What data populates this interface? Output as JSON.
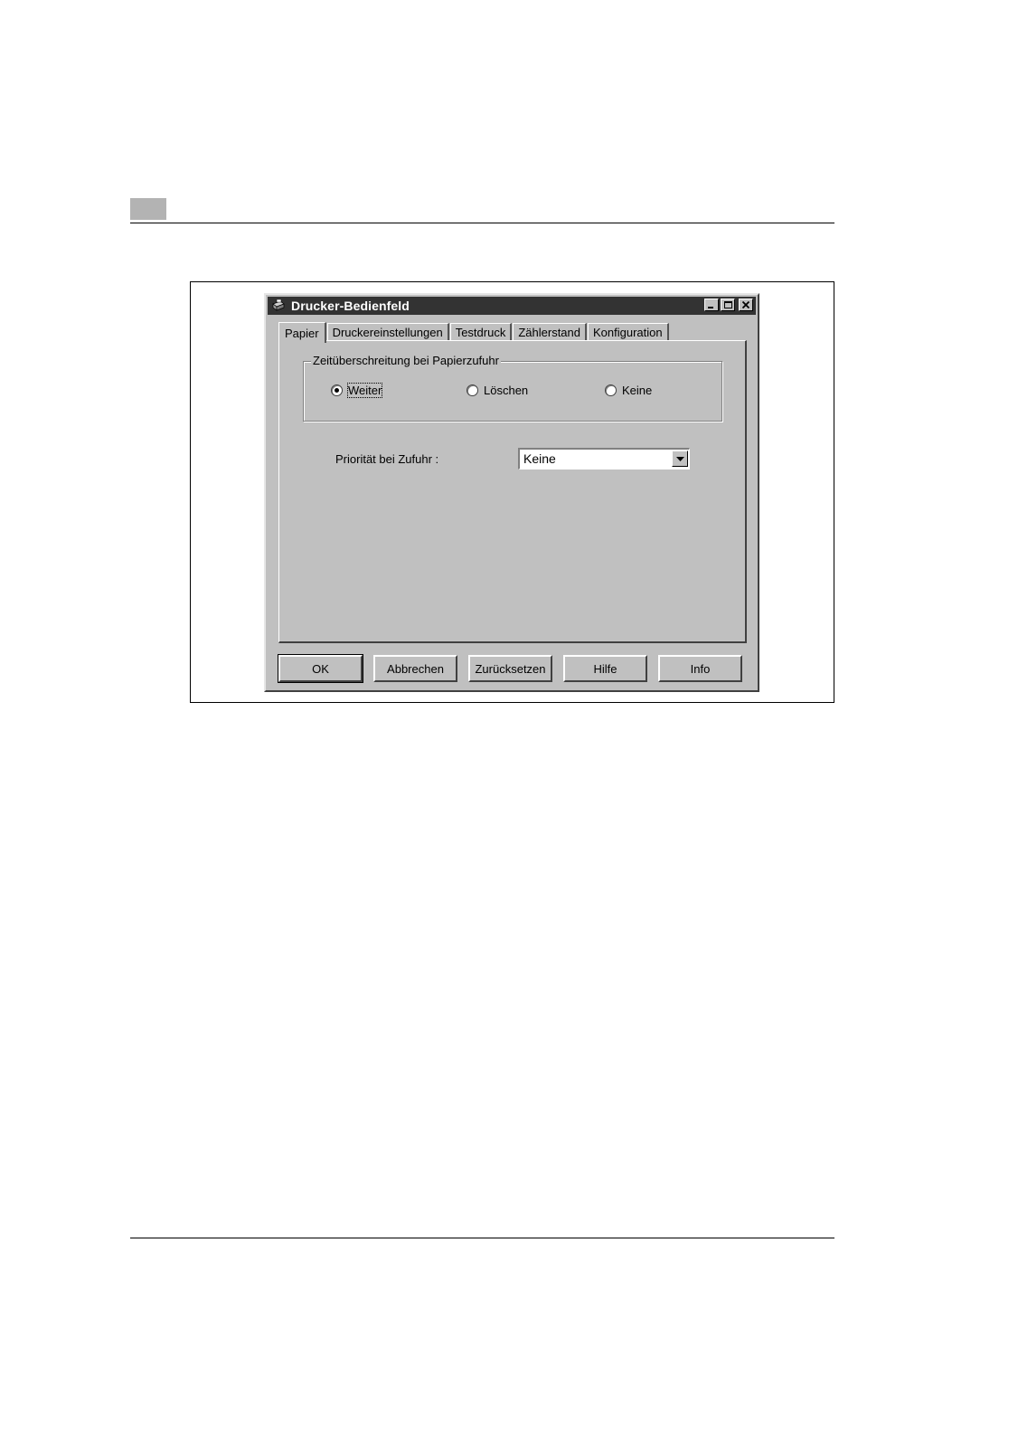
{
  "dialog": {
    "title": "Drucker-Bedienfeld"
  },
  "tabs": [
    {
      "label": "Papier",
      "active": true
    },
    {
      "label": "Druckereinstellungen",
      "active": false
    },
    {
      "label": "Testdruck",
      "active": false
    },
    {
      "label": "Zählerstand",
      "active": false
    },
    {
      "label": "Konfiguration",
      "active": false
    }
  ],
  "paper_feed_timeout": {
    "group_label": "Zeitüberschreitung bei Papierzufuhr",
    "options": [
      {
        "label": "Weiter",
        "selected": true
      },
      {
        "label": "Löschen",
        "selected": false
      },
      {
        "label": "Keine",
        "selected": false
      }
    ]
  },
  "feed_priority": {
    "label": "Priorität bei Zufuhr :",
    "value": "Keine"
  },
  "buttons": {
    "ok": "OK",
    "cancel": "Abbrechen",
    "reset": "Zurücksetzen",
    "help": "Hilfe",
    "info": "Info"
  },
  "icons": {
    "app": "printer-icon",
    "minimize": "minimize-icon",
    "maximize": "maximize-icon",
    "close": "close-icon",
    "dropdown": "chevron-down-icon"
  },
  "colors": {
    "titlebar": "#333333",
    "dialog_face": "#c0c0c0"
  }
}
